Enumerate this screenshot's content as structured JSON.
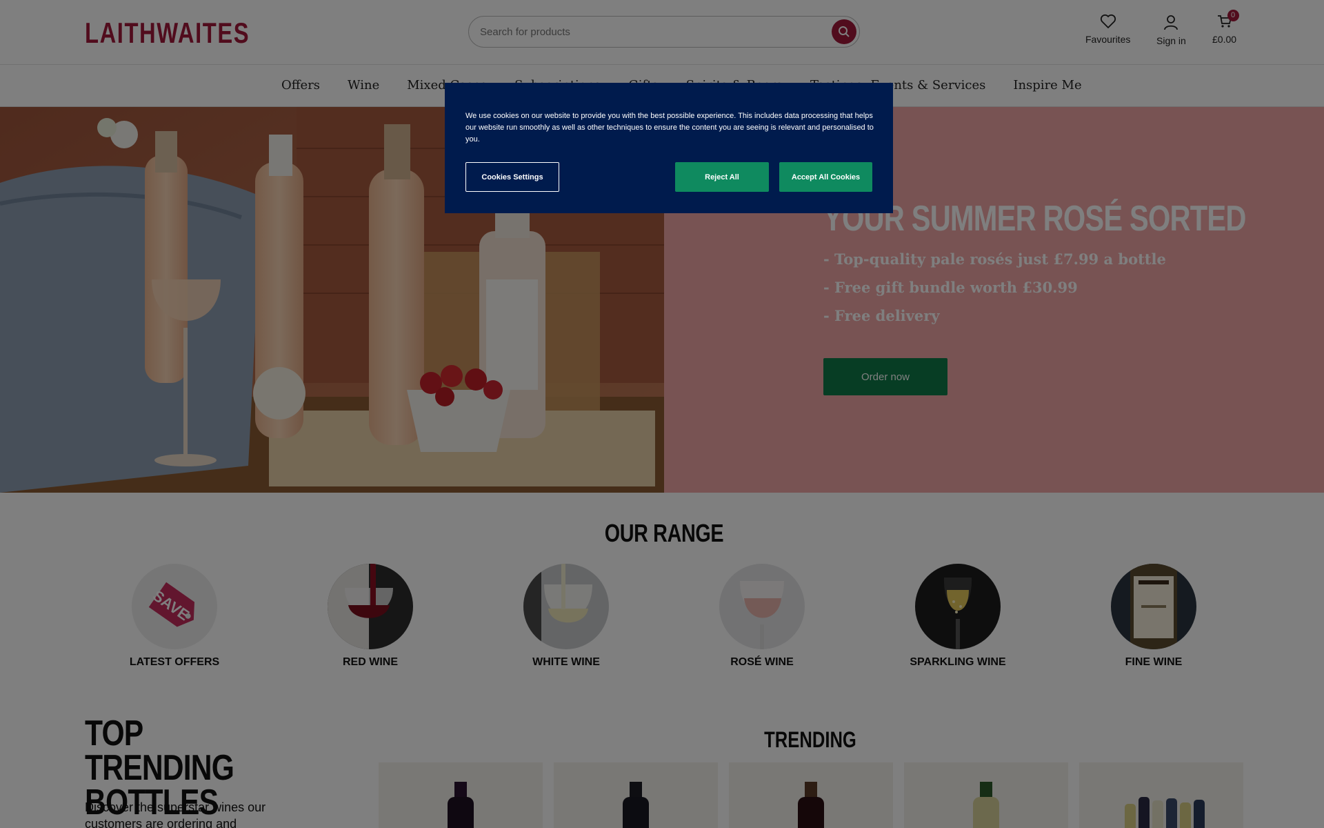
{
  "header": {
    "logo": "LAITHWAITES",
    "search_placeholder": "Search for products",
    "favourites_label": "Favourites",
    "signin_label": "Sign in",
    "cart_total": "£0.00",
    "cart_count": "0"
  },
  "nav": {
    "items": [
      "Offers",
      "Wine",
      "Mixed Cases",
      "Subscriptions",
      "Gifts",
      "Spirits & Beers",
      "Tastings, Events & Services",
      "Inspire Me"
    ]
  },
  "hero": {
    "title": "YOUR SUMMER ROSÉ SORTED",
    "bullets": [
      "- Top-quality pale rosés just £7.99 a bottle",
      "- Free gift bundle worth £30.99",
      "- Free delivery"
    ],
    "cta": "Order now"
  },
  "range": {
    "title": "OUR RANGE",
    "items": [
      {
        "label": "LATEST OFFERS"
      },
      {
        "label": "RED WINE"
      },
      {
        "label": "WHITE WINE"
      },
      {
        "label": "ROSÉ WINE"
      },
      {
        "label": "SPARKLING WINE"
      },
      {
        "label": "FINE WINE"
      }
    ]
  },
  "trending": {
    "heading": "TOP TRENDING BOTTLES",
    "description": "Discover the superstar wines our customers are ordering and",
    "section_title": "TRENDING"
  },
  "cookie": {
    "text": "We use cookies on our website to provide you with the best possible experience. This includes data processing that helps our website run smoothly as well as other techniques to ensure the content you are seeing is relevant and personalised to you.",
    "settings_label": "Cookies Settings",
    "reject_label": "Reject All",
    "accept_label": "Accept All Cookies"
  },
  "colors": {
    "brand": "#a3183a",
    "hero_bg": "#f0a7a7",
    "cta_green": "#0f7a48",
    "cookie_bg": "#001b4d"
  }
}
